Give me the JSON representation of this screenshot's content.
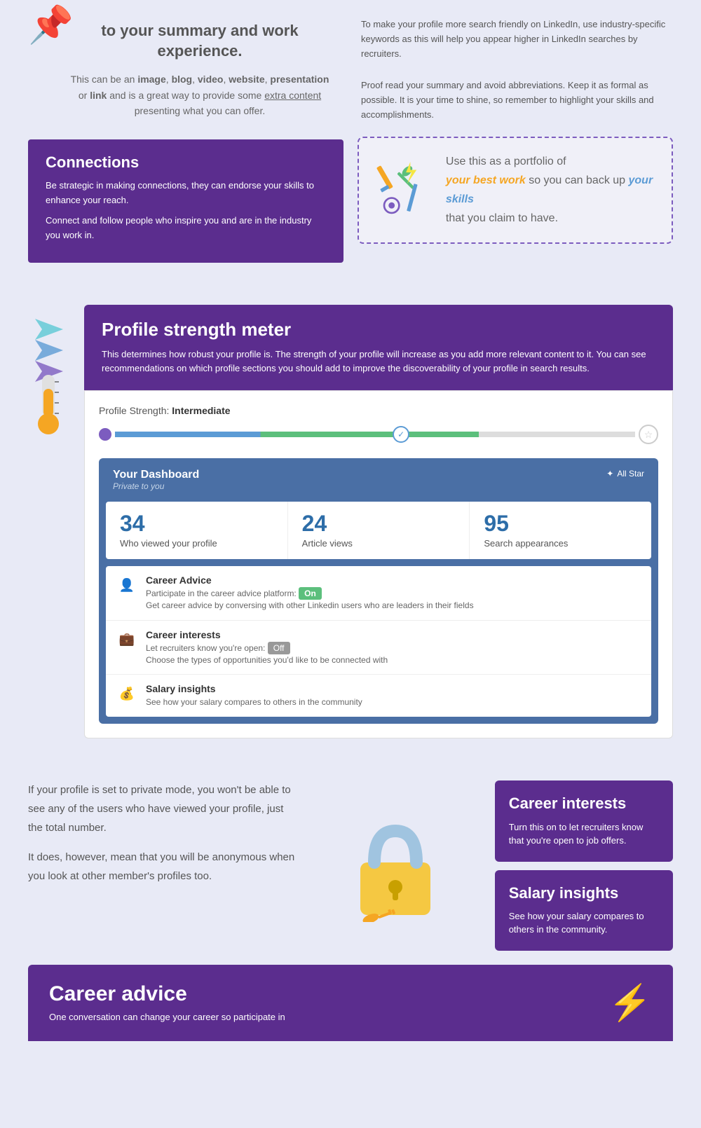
{
  "top": {
    "left": {
      "heading": "to your summary and work experience.",
      "body": "This can be an image, blog, video, website, presentation or link and is a great way to provide some extra content presenting what you can offer.",
      "connections": {
        "title": "Connections",
        "para1": "Be strategic in making connections, they can endorse your skills to enhance your reach.",
        "para2": "Connect and follow people who inspire you and are in the industry you work in."
      }
    },
    "right": {
      "tip1": "To make your profile more search friendly on LinkedIn, use industry-specific keywords as this will help you appear higher in LinkedIn searches by recruiters.",
      "tip2": "Proof read your summary and avoid abbreviations. Keep it as formal as possible. It is your time to shine, so remember to highlight your skills and accomplishments.",
      "portfolio": {
        "line1": "Use this as a portfolio of",
        "orange1": "your best work",
        "line2": "so you can back up",
        "blue1": "your skills",
        "line3": "that you claim to have."
      }
    }
  },
  "strength": {
    "title": "Profile strength meter",
    "description": "This determines how robust your profile is. The strength of your profile will increase as you add more relevant content to it. You can see recommendations on which profile sections you should add to improve the discoverability of your profile in search results.",
    "label": "Profile Strength:",
    "level": "Intermediate",
    "progress_percent": 60,
    "dashboard": {
      "title": "Your Dashboard",
      "subtitle": "Private to you",
      "badge": "All Star",
      "stats": [
        {
          "number": "34",
          "label": "Who viewed your profile"
        },
        {
          "number": "24",
          "label": "Article views"
        },
        {
          "number": "95",
          "label": "Search appearances"
        }
      ],
      "features": [
        {
          "icon": "👤",
          "title": "Career Advice",
          "toggle": "On",
          "toggle_state": "on",
          "desc": "Get career advice by conversing with other Linkedin users who are leaders in their fields",
          "prefix": "Participate in the career advice platform:"
        },
        {
          "icon": "💼",
          "title": "Career interests",
          "toggle": "Off",
          "toggle_state": "off",
          "desc": "Choose the types of opportunities you'd like to be connected with",
          "prefix": "Let recruiters know you're open:"
        },
        {
          "icon": "💰",
          "title": "Salary insights",
          "toggle": null,
          "desc": "See how your salary compares to others in the community"
        }
      ]
    }
  },
  "bottom": {
    "private_mode": {
      "para1": "If your profile is set to private mode, you won't be able to see any of the users who have viewed your profile, just the total number.",
      "para2": "It does, however, mean that you will be anonymous when you look at other member's profiles too."
    },
    "career_interests": {
      "title": "Career interests",
      "desc": "Turn this on to let recruiters know that you're open to job offers."
    },
    "salary_insights": {
      "title": "Salary insights",
      "desc": "See how your salary compares to others in the community."
    },
    "career_advice": {
      "title": "Career advice",
      "desc": "One conversation can change your career so participate in"
    }
  },
  "icons": {
    "pin": "📌",
    "star": "☆",
    "check": "✓",
    "allstar": "✦",
    "lightning": "⚡"
  }
}
